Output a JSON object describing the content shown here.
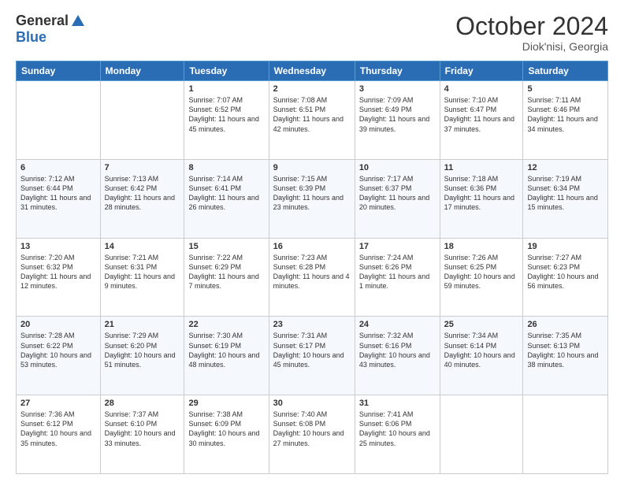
{
  "header": {
    "logo_general": "General",
    "logo_blue": "Blue",
    "month_title": "October 2024",
    "location": "Diok'nisi, Georgia"
  },
  "weekdays": [
    "Sunday",
    "Monday",
    "Tuesday",
    "Wednesday",
    "Thursday",
    "Friday",
    "Saturday"
  ],
  "weeks": [
    [
      {
        "day": null
      },
      {
        "day": null
      },
      {
        "day": "1",
        "sunrise": "7:07 AM",
        "sunset": "6:52 PM",
        "daylight": "11 hours and 45 minutes."
      },
      {
        "day": "2",
        "sunrise": "7:08 AM",
        "sunset": "6:51 PM",
        "daylight": "11 hours and 42 minutes."
      },
      {
        "day": "3",
        "sunrise": "7:09 AM",
        "sunset": "6:49 PM",
        "daylight": "11 hours and 39 minutes."
      },
      {
        "day": "4",
        "sunrise": "7:10 AM",
        "sunset": "6:47 PM",
        "daylight": "11 hours and 37 minutes."
      },
      {
        "day": "5",
        "sunrise": "7:11 AM",
        "sunset": "6:46 PM",
        "daylight": "11 hours and 34 minutes."
      }
    ],
    [
      {
        "day": "6",
        "sunrise": "7:12 AM",
        "sunset": "6:44 PM",
        "daylight": "11 hours and 31 minutes."
      },
      {
        "day": "7",
        "sunrise": "7:13 AM",
        "sunset": "6:42 PM",
        "daylight": "11 hours and 28 minutes."
      },
      {
        "day": "8",
        "sunrise": "7:14 AM",
        "sunset": "6:41 PM",
        "daylight": "11 hours and 26 minutes."
      },
      {
        "day": "9",
        "sunrise": "7:15 AM",
        "sunset": "6:39 PM",
        "daylight": "11 hours and 23 minutes."
      },
      {
        "day": "10",
        "sunrise": "7:17 AM",
        "sunset": "6:37 PM",
        "daylight": "11 hours and 20 minutes."
      },
      {
        "day": "11",
        "sunrise": "7:18 AM",
        "sunset": "6:36 PM",
        "daylight": "11 hours and 17 minutes."
      },
      {
        "day": "12",
        "sunrise": "7:19 AM",
        "sunset": "6:34 PM",
        "daylight": "11 hours and 15 minutes."
      }
    ],
    [
      {
        "day": "13",
        "sunrise": "7:20 AM",
        "sunset": "6:32 PM",
        "daylight": "11 hours and 12 minutes."
      },
      {
        "day": "14",
        "sunrise": "7:21 AM",
        "sunset": "6:31 PM",
        "daylight": "11 hours and 9 minutes."
      },
      {
        "day": "15",
        "sunrise": "7:22 AM",
        "sunset": "6:29 PM",
        "daylight": "11 hours and 7 minutes."
      },
      {
        "day": "16",
        "sunrise": "7:23 AM",
        "sunset": "6:28 PM",
        "daylight": "11 hours and 4 minutes."
      },
      {
        "day": "17",
        "sunrise": "7:24 AM",
        "sunset": "6:26 PM",
        "daylight": "11 hours and 1 minute."
      },
      {
        "day": "18",
        "sunrise": "7:26 AM",
        "sunset": "6:25 PM",
        "daylight": "10 hours and 59 minutes."
      },
      {
        "day": "19",
        "sunrise": "7:27 AM",
        "sunset": "6:23 PM",
        "daylight": "10 hours and 56 minutes."
      }
    ],
    [
      {
        "day": "20",
        "sunrise": "7:28 AM",
        "sunset": "6:22 PM",
        "daylight": "10 hours and 53 minutes."
      },
      {
        "day": "21",
        "sunrise": "7:29 AM",
        "sunset": "6:20 PM",
        "daylight": "10 hours and 51 minutes."
      },
      {
        "day": "22",
        "sunrise": "7:30 AM",
        "sunset": "6:19 PM",
        "daylight": "10 hours and 48 minutes."
      },
      {
        "day": "23",
        "sunrise": "7:31 AM",
        "sunset": "6:17 PM",
        "daylight": "10 hours and 45 minutes."
      },
      {
        "day": "24",
        "sunrise": "7:32 AM",
        "sunset": "6:16 PM",
        "daylight": "10 hours and 43 minutes."
      },
      {
        "day": "25",
        "sunrise": "7:34 AM",
        "sunset": "6:14 PM",
        "daylight": "10 hours and 40 minutes."
      },
      {
        "day": "26",
        "sunrise": "7:35 AM",
        "sunset": "6:13 PM",
        "daylight": "10 hours and 38 minutes."
      }
    ],
    [
      {
        "day": "27",
        "sunrise": "7:36 AM",
        "sunset": "6:12 PM",
        "daylight": "10 hours and 35 minutes."
      },
      {
        "day": "28",
        "sunrise": "7:37 AM",
        "sunset": "6:10 PM",
        "daylight": "10 hours and 33 minutes."
      },
      {
        "day": "29",
        "sunrise": "7:38 AM",
        "sunset": "6:09 PM",
        "daylight": "10 hours and 30 minutes."
      },
      {
        "day": "30",
        "sunrise": "7:40 AM",
        "sunset": "6:08 PM",
        "daylight": "10 hours and 27 minutes."
      },
      {
        "day": "31",
        "sunrise": "7:41 AM",
        "sunset": "6:06 PM",
        "daylight": "10 hours and 25 minutes."
      },
      {
        "day": null
      },
      {
        "day": null
      }
    ]
  ]
}
